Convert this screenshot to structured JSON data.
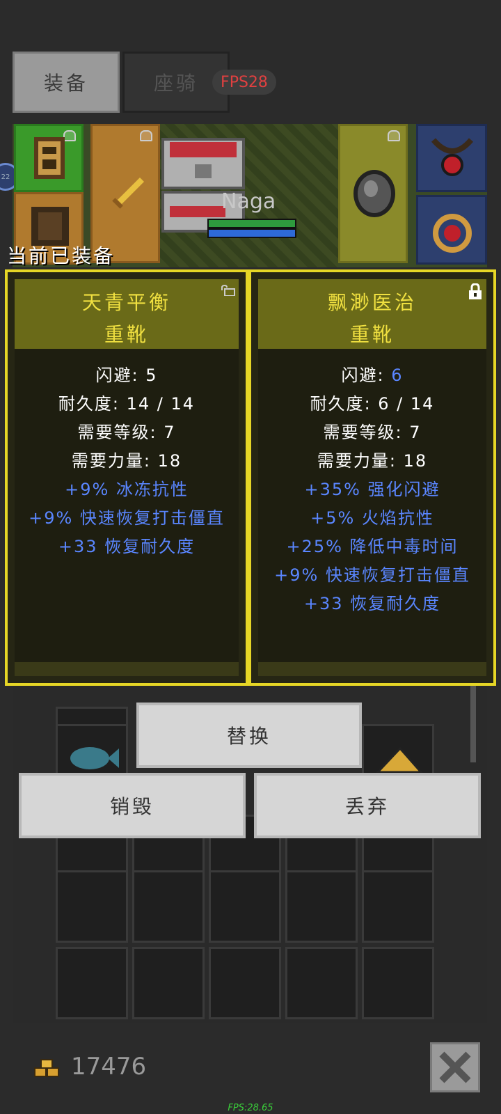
{
  "tabs": {
    "equip": "装备",
    "mount": "座骑"
  },
  "fps_badge": "FPS28",
  "character": {
    "name": "Naga",
    "level_badge": "22"
  },
  "current_equipped_label": "当前已装备",
  "card_left": {
    "name": "天青平衡",
    "type": "重靴",
    "stats": [
      {
        "label": "闪避",
        "value": "5"
      },
      {
        "label": "耐久度",
        "value": "14 / 14"
      },
      {
        "label": "需要等级",
        "value": "7"
      },
      {
        "label": "需要力量",
        "value": "18"
      }
    ],
    "affixes": [
      "+9% 冰冻抗性",
      "+9% 快速恢复打击僵直",
      "+33 恢复耐久度"
    ]
  },
  "card_right": {
    "name": "飘渺医治",
    "type": "重靴",
    "stats": [
      {
        "label": "闪避",
        "value": "6"
      },
      {
        "label": "耐久度",
        "value": "6 / 14"
      },
      {
        "label": "需要等级",
        "value": "7"
      },
      {
        "label": "需要力量",
        "value": "18"
      }
    ],
    "affixes": [
      "+35% 强化闪避",
      "+5% 火焰抗性",
      "+25% 降低中毒时间",
      "+9% 快速恢复打击僵直",
      "+33 恢复耐久度"
    ]
  },
  "buttons": {
    "replace": "替换",
    "destroy": "销毁",
    "discard": "丢弃"
  },
  "gold": "17476",
  "fps_text": "FPS:28.65",
  "colors": {
    "card_border": "#e6d626",
    "title_yellow": "#f0e040",
    "affix_blue": "#5a86ff"
  }
}
